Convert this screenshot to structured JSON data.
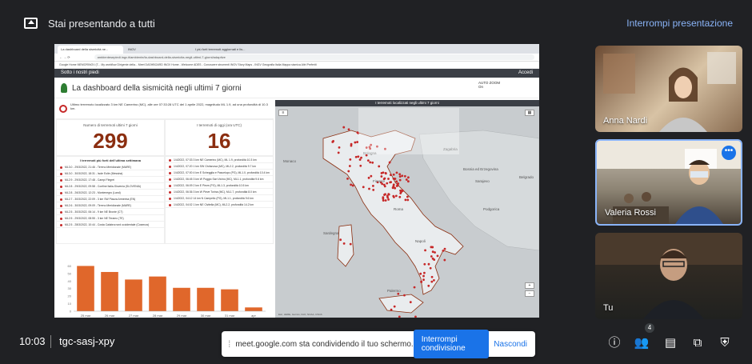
{
  "presentation": {
    "title": "Stai presentando a tutti",
    "stop_label": "Interrompi presentazione"
  },
  "browser": {
    "tabs": [
      "La dashboard della sismicità ne...",
      "INGV",
      "I più forti terremoti aggiornati e lis..."
    ],
    "url": "ambientesepiedi.ingv.it/ambiente/la-dashboard-della-sismicita-negli-ultimi-7-giorni/adaptive",
    "bookmarks": "Google  Home  MEMORINGV (T...  My workflow  Dirigente della...  Meet  DASHBOARD INGV  Home - Welcome  ADES - Conoscere  strumenti INGV  Story Maps - INGV  Geografia Italia  Mappa sismica  Altri Preferiti"
  },
  "app": {
    "name": "Sotto i nostri piedi",
    "right": "Accedi"
  },
  "dashboard": {
    "title": "La dashboard della sismicità negli ultimi 7 giorni",
    "autozoom_label": "AUTO ZOOM",
    "autozoom_value": "On",
    "latest_quake": "Ultimo terremoto localizzato 3 km NE Camerino (MC), alle ore 07:33:28 UTC del 1 aprile 2022, magnitudo ML 1.9, ad una profondità di 10.3 km.",
    "counter_week_label": "Numero di terremoti ultimi 7 giorni",
    "counter_week_value": "299",
    "counter_today_label": "I terremoti di oggi (ora UTC)",
    "counter_today_value": "16",
    "list_strongest_title": "I terremoti più forti dell'ultima settimana",
    "list_strongest": [
      "ML3.0 - 29/3/2022, 21:46 - Tirreno Meridionale (MARE)",
      "ML3.0 - 30/3/2022, 18:31 - Isole Eolie (Messina)",
      "ML2.9 - 29/3/2022, 17:48 - Campi Flegrei",
      "ML2.8 - 29/3/2022, 09:58 - Confine Italia-Slovenia (SLOVENIA)",
      "ML2.8 - 26/3/2022, 12:23 - Montenegro (Land)",
      "ML2.7 - 30/3/2022, 22:09 - 3 km SW Piazza Armerina (EN)",
      "ML2.6 - 30/3/2022, 09:09 - Tirreno Meridionale (MARE)",
      "ML2.5 - 30/3/2022, 06:14 - 9 km NE Bronte (CT)",
      "ML2.5 - 29/3/2022, 08:55 - 3 km NE Teramo (TE)",
      "ML2.5 - 28/3/2022, 10:44 - Costa Calabra nord occidentale (Cosenza)"
    ],
    "list_today_title": "",
    "list_today": [
      "1/4/2022, 07:33 3 km NE Camerino (MC), ML 1.9, profondità 10.3 km",
      "1/4/2022, 07:20 1 km SW Civitanova (MC), ML2.2, profondità 9.7 km",
      "1/4/2022, 07:00 4 km E Schegglia e Pascelupo (PG), ML1.0, profondità 10.4 km",
      "1/4/2022, 06:45 3 km W Poggio San Vicino (MC), ML1.1, profondità 9.6 km",
      "1/4/2022, 06:09 2 km E Pieve (PG), ML1.3, profondità 10.5 km",
      "1/4/2022, 06:36 3 km W Pieve Torina (MC), ML1.7, profondità 8.0 km",
      "1/4/2022, 04:12 14 km N Campello (PG), ML1.1, profondità 9.6 km",
      "1/4/2022, 04:02 1 km NE Civitella (MC), ML2.2, profondità 14.2 km"
    ],
    "map_title": "I terremoti localizzati negli ultimi 7 giorni",
    "map_credit": "Esri, HERE, Garmin, FAO, NOAA, USGS",
    "map_labels": [
      "Monaco",
      "Bologna",
      "Firenze",
      "Roma",
      "Napoli",
      "Palermo",
      "Sardegna",
      "Zagabria",
      "Sarajevo",
      "Belgrado",
      "Bosnia ed Erzegovina",
      "Podgorica"
    ]
  },
  "chart_data": {
    "type": "bar",
    "categories": [
      "25 mar",
      "26 mar",
      "27 mar",
      "28 mar",
      "29 mar",
      "30 mar",
      "31 mar",
      "apr"
    ],
    "values": [
      60,
      52,
      42,
      46,
      31,
      31,
      29,
      5
    ],
    "ylim": [
      0,
      70
    ],
    "yticks": [
      0,
      10,
      20,
      30,
      40,
      50,
      60
    ],
    "color": "#e0672b",
    "title": "",
    "xlabel": "",
    "ylabel": ""
  },
  "participants": [
    {
      "name": "Anna Nardi"
    },
    {
      "name": "Valeria Rossi"
    },
    {
      "name": "Tu"
    }
  ],
  "meeting": {
    "time": "10:03",
    "code": "tgc-sasj-xpy",
    "participant_count": "4"
  },
  "share_banner": {
    "text": "meet.google.com sta condividendo il tuo schermo.",
    "stop_label": "Interrompi condivisione",
    "hide_label": "Nascondi"
  },
  "icons": {
    "info": "info-icon",
    "people": "people-icon",
    "chat": "chat-icon",
    "activities": "activities-icon",
    "host": "host-controls-icon"
  }
}
